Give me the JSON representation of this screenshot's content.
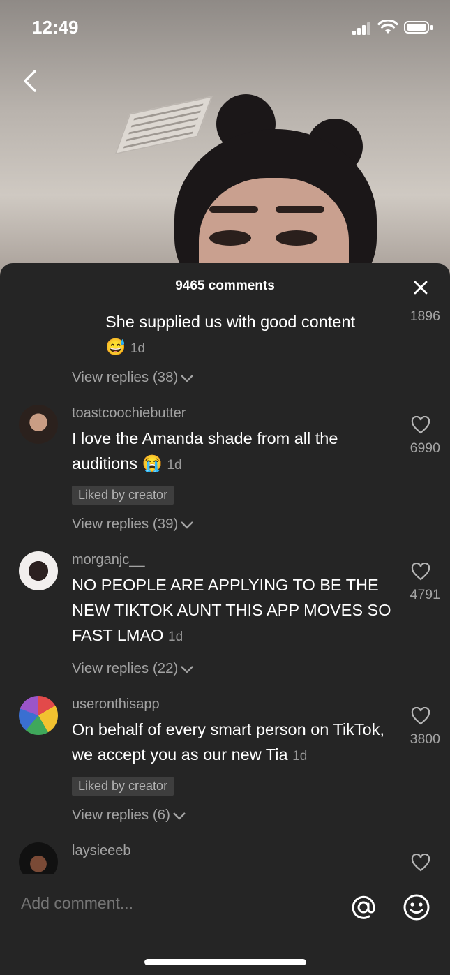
{
  "status_bar": {
    "time": "12:49"
  },
  "sheet": {
    "title": "9465 comments"
  },
  "comments": [
    {
      "text": "She supplied us with good content",
      "emoji": "😅",
      "age": "1d",
      "likes": "1896",
      "replies": "View replies (38)"
    },
    {
      "username": "toastcoochiebutter",
      "text": "I love the Amanda shade from all the auditions",
      "emoji": "😭",
      "age": "1d",
      "likes": "6990",
      "liked_badge": "Liked by creator",
      "replies": "View replies (39)"
    },
    {
      "username": "morganjc__",
      "text": "NO PEOPLE ARE APPLYING TO BE THE NEW TIKTOK AUNT THIS APP MOVES SO FAST LMAO",
      "age": "1d",
      "likes": "4791",
      "replies": "View replies (22)"
    },
    {
      "username": "useronthisapp",
      "text": "On behalf of every smart person on TikTok, we accept you as our new Tia",
      "age": "1d",
      "likes": "3800",
      "liked_badge": "Liked by creator",
      "replies": "View replies (6)"
    },
    {
      "username": "laysieeeb"
    }
  ],
  "composer": {
    "placeholder": "Add comment..."
  }
}
